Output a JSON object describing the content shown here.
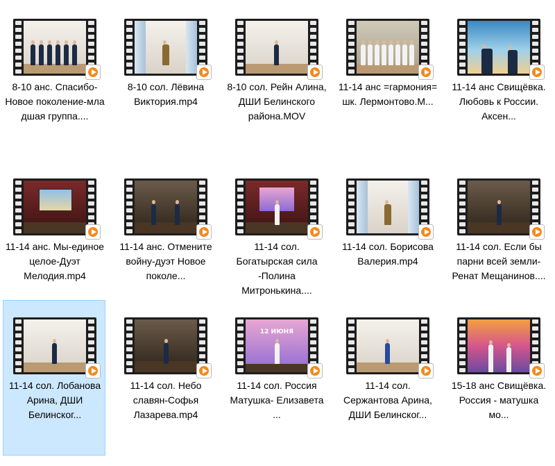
{
  "files": [
    {
      "label": "8-10 анс. Спасибо-Новое поколение-мла дшая группа....",
      "selected": false,
      "scene": "group-light"
    },
    {
      "label": "8-10 сол. Лёвина Виктория.mp4",
      "selected": false,
      "scene": "solo-curtain"
    },
    {
      "label": "8-10 сол. Рейн Алина, ДШИ Белинского района.MOV",
      "selected": false,
      "scene": "solo-wall"
    },
    {
      "label": "11-14 анс =гармония= шк. Лермонтово.М...",
      "selected": false,
      "scene": "group-choir"
    },
    {
      "label": "11-14 анс Свищёвка. Любовь к России. Аксен...",
      "selected": false,
      "scene": "duo-sky"
    },
    {
      "label": "11-14 анс. Мы-единое целое-Дуэт Мелодия.mp4",
      "selected": false,
      "scene": "stage-screen"
    },
    {
      "label": "11-14 анс. Отмените войну-дуэт Новое поколе...",
      "selected": false,
      "scene": "duo-stage"
    },
    {
      "label": "11-14 сол. Богатырская сила -Полина Митронькина....",
      "selected": false,
      "scene": "stage-pink"
    },
    {
      "label": "11-14 сол. Борисова Валерия.mp4",
      "selected": false,
      "scene": "solo-curtain"
    },
    {
      "label": "11-14 сол. Если бы парни всей земли-Ренат Мещанинов....",
      "selected": false,
      "scene": "solo-stage"
    },
    {
      "label": "11-14 сол. Лобанова Арина, ДШИ Белинског...",
      "selected": true,
      "scene": "solo-wall"
    },
    {
      "label": "11-14 сол. Небо славян-Софья Лазарева.mp4",
      "selected": false,
      "scene": "solo-stage"
    },
    {
      "label": "11-14 сол. Россия Матушка- Елизавета ...",
      "selected": false,
      "scene": "banner"
    },
    {
      "label": "11-14 сол. Сержантова Арина, ДШИ Белинског...",
      "selected": false,
      "scene": "solo-wall-blue"
    },
    {
      "label": "15-18 анс Свищёвка. Россия - матушка мо...",
      "selected": false,
      "scene": "duo-sunset"
    }
  ],
  "banner_text": "12 ИЮНЯ",
  "colors": {
    "selection_bg": "#cce8ff",
    "selection_border": "#99d1ff",
    "play_badge": "#f28a1e"
  }
}
